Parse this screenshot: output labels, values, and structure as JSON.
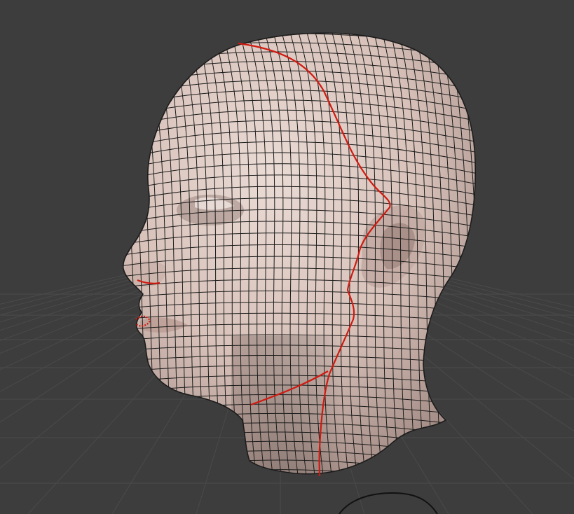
{
  "viewport": {
    "background_color": "#3d3d3d",
    "grid_color": "#4a4a4a",
    "mesh_object": "head",
    "mesh_fill_color": "#d9c4bd",
    "mesh_shadow_color": "#a9928b",
    "wire_color": "#1c1c1c",
    "seam_color": "#d01a10",
    "modifier": "subdivision-surface-with-wireframe-overlay"
  },
  "icons": {
    "gizmo": "orbit-gizmo-icon"
  }
}
